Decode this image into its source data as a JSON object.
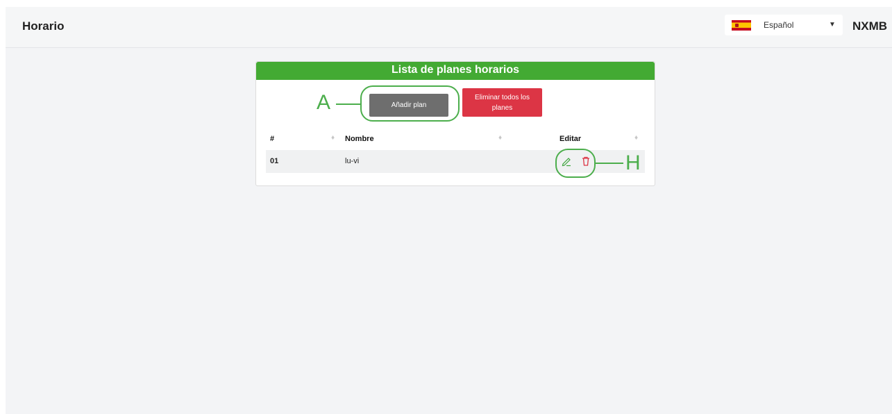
{
  "header": {
    "title": "Horario",
    "language": "Español",
    "user": "NXMB"
  },
  "card": {
    "title": "Lista de planes horarios",
    "add_button": "Añadir plan",
    "delete_all_button": "Eliminar todos los planes"
  },
  "table": {
    "columns": [
      "#",
      "Nombre",
      "Editar"
    ],
    "rows": [
      {
        "num": "01",
        "name": "lu-vi"
      }
    ]
  },
  "annotations": {
    "a": "A",
    "h": "H"
  },
  "colors": {
    "header_green": "#43aa33",
    "delete_red": "#dc3545",
    "add_gray": "#6e6e6e",
    "annotation_green": "#4cae4c"
  }
}
